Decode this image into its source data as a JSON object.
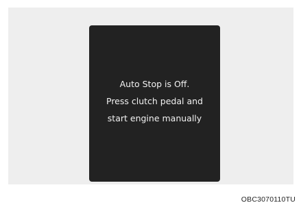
{
  "display": {
    "message_lines": [
      "Auto Stop is Off.",
      "Press clutch pedal and",
      "start engine manually"
    ]
  },
  "figure": {
    "code": "OBC3070110TU"
  },
  "colors": {
    "background": "#eeeeee",
    "display_panel": "#222222",
    "display_text": "#f2f2f2"
  }
}
